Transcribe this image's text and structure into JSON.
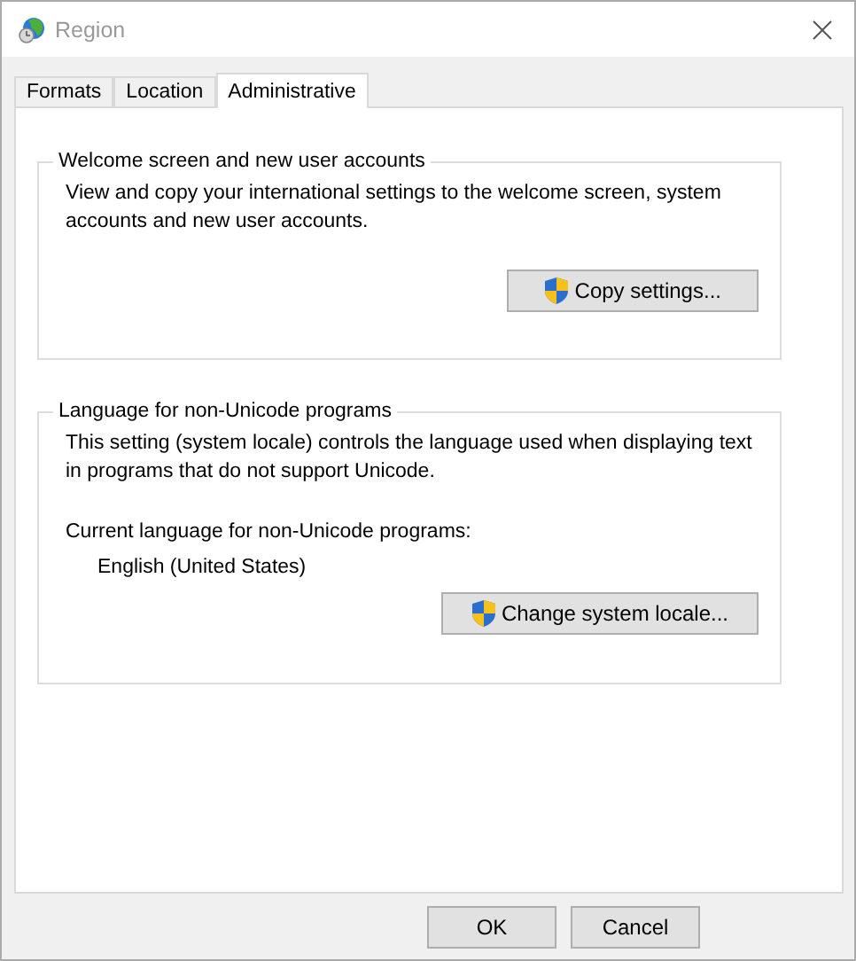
{
  "window": {
    "title": "Region"
  },
  "tabs": [
    {
      "label": "Formats",
      "selected": false
    },
    {
      "label": "Location",
      "selected": false
    },
    {
      "label": "Administrative",
      "selected": true
    }
  ],
  "groups": [
    {
      "title": "Welcome screen and new user accounts",
      "description": "View and copy your international settings to the welcome screen, system accounts and new user accounts.",
      "button": "Copy settings..."
    },
    {
      "title": "Language for non-Unicode programs",
      "description": "This setting (system locale) controls the language used when displaying text in programs that do not support Unicode.",
      "current_label": "Current language for non-Unicode programs:",
      "current_value": "English (United States)",
      "button": "Change system locale..."
    }
  ],
  "buttons": [
    "OK",
    "Cancel"
  ]
}
